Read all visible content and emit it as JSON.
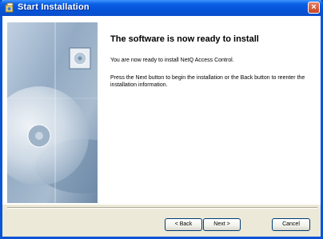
{
  "window": {
    "title": "Start Installation",
    "close_glyph": "×"
  },
  "content": {
    "heading": "The software is now ready to install",
    "paragraph1": "You are now ready to install NetQ Access Control.",
    "paragraph2": "Press the Next button to begin the installation or the Back button to reenter the installation information."
  },
  "buttons": {
    "back_label": "< Back",
    "next_label": "Next >",
    "cancel_label": "Cancel"
  },
  "icons": {
    "title_icon": "installer-icon",
    "side_image": "cd-disc-graphic"
  },
  "colors": {
    "titlebar": "#0553d9",
    "window_bg": "#ece9d8",
    "close_button": "#c7431f"
  }
}
